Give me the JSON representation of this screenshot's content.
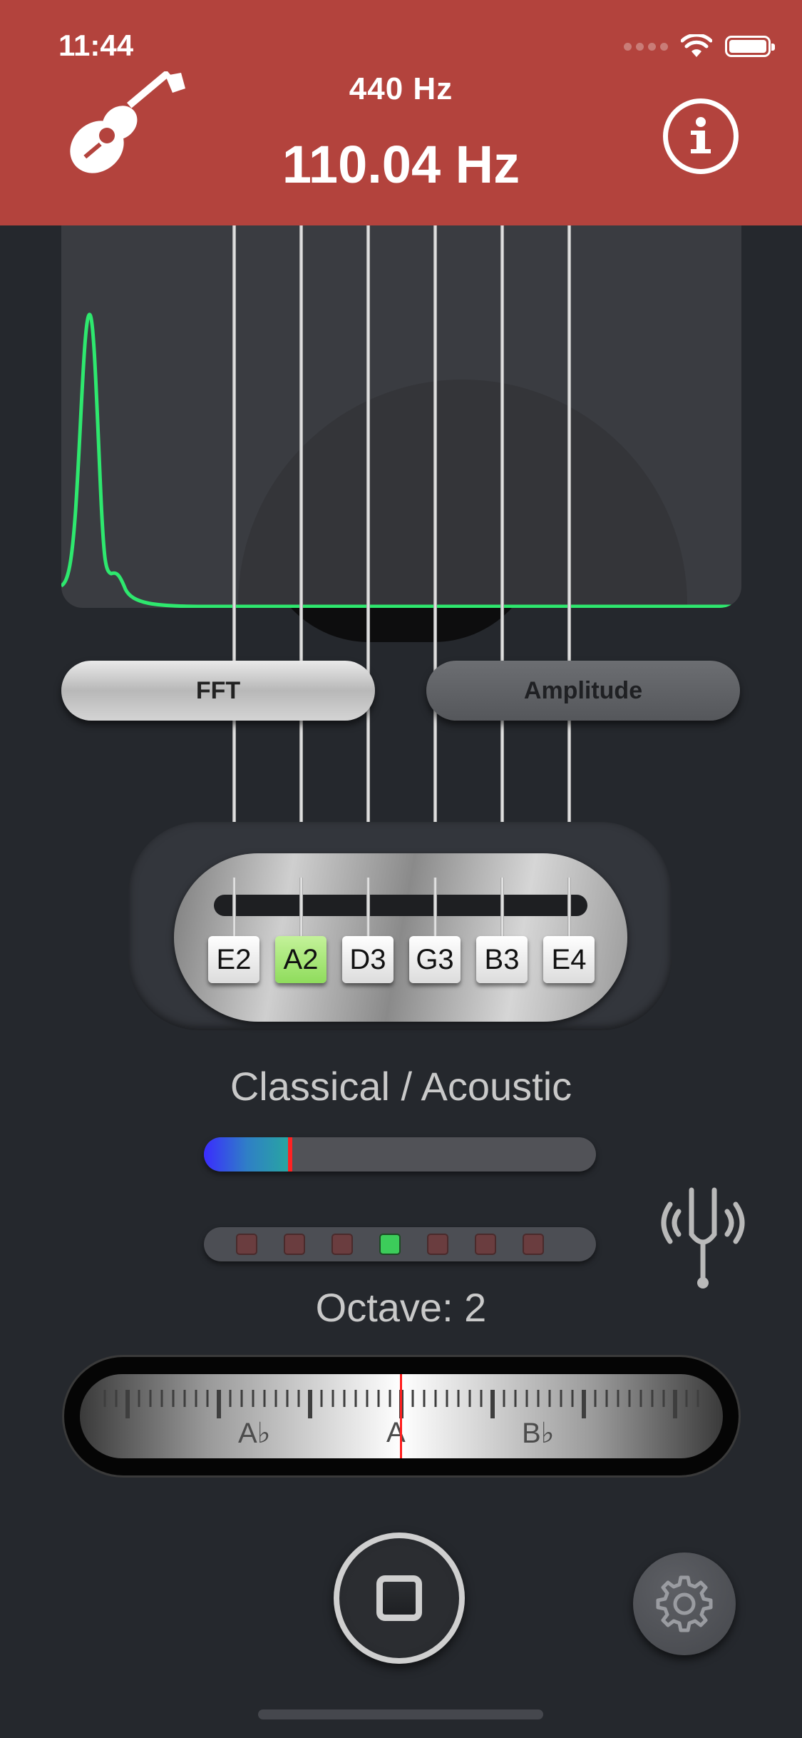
{
  "status_bar": {
    "time": "11:44"
  },
  "header": {
    "reference_frequency": "440 Hz",
    "detected_frequency": "110.04 Hz",
    "left_icon": "guitar-icon",
    "info_icon": "info-icon"
  },
  "spectrum": {
    "line_color": "#2ee86e"
  },
  "display_modes": {
    "fft_label": "FFT",
    "amplitude_label": "Amplitude",
    "selected": "FFT"
  },
  "strings": {
    "notes": [
      "E2",
      "A2",
      "D3",
      "G3",
      "B3",
      "E4"
    ],
    "selected": "A2"
  },
  "tuning": {
    "name": "Classical / Acoustic"
  },
  "level": {
    "fraction": 0.22
  },
  "leds": {
    "count": 7,
    "lit_index": 3
  },
  "octave": {
    "label": "Octave: 2"
  },
  "dial": {
    "labels": [
      "A♭",
      "A",
      "B♭"
    ]
  },
  "controls": {
    "stop_icon": "stop-icon",
    "settings_icon": "gear-icon",
    "fork_icon": "tuning-fork-icon"
  }
}
